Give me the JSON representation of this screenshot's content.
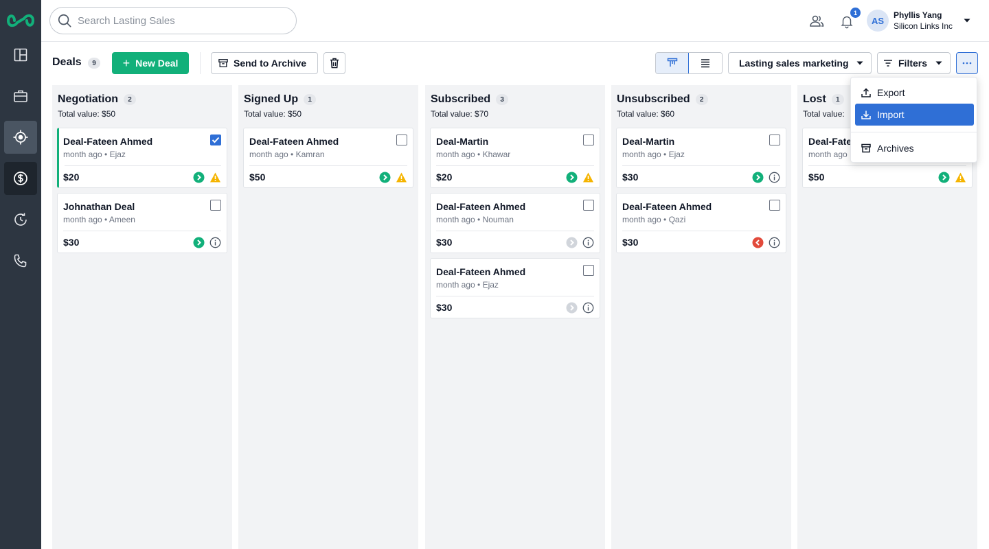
{
  "search": {
    "placeholder": "Search Lasting Sales"
  },
  "header": {
    "notifications_count": "1",
    "user": {
      "initials": "AS",
      "name": "Phyllis Yang",
      "company": "Silicon Links Inc"
    }
  },
  "toolbar": {
    "title": "Deals",
    "count": "9",
    "new_deal_label": "New Deal",
    "archive_label": "Send to Archive",
    "pipeline_label": "Lasting sales marketing",
    "filters_label": "Filters"
  },
  "columns": [
    {
      "title": "Negotiation",
      "count": "2",
      "total": "Total value: $50",
      "cards": [
        {
          "title": "Deal-Fateen Ahmed",
          "meta": "month ago • Ejaz",
          "value": "$20",
          "checked": true,
          "status": "green",
          "alert": "warning"
        },
        {
          "title": "Johnathan Deal",
          "meta": "month ago • Ameen",
          "value": "$30",
          "checked": false,
          "status": "green",
          "alert": "info"
        }
      ]
    },
    {
      "title": "Signed Up",
      "count": "1",
      "total": "Total value: $50",
      "cards": [
        {
          "title": "Deal-Fateen Ahmed",
          "meta": "month ago • Kamran",
          "value": "$50",
          "checked": false,
          "status": "green",
          "alert": "warning"
        }
      ]
    },
    {
      "title": "Subscribed",
      "count": "3",
      "total": "Total value: $70",
      "cards": [
        {
          "title": "Deal-Martin",
          "meta": "month ago • Khawar",
          "value": "$20",
          "checked": false,
          "status": "green",
          "alert": "warning"
        },
        {
          "title": "Deal-Fateen Ahmed",
          "meta": "month ago • Nouman",
          "value": "$30",
          "checked": false,
          "status": "gray",
          "alert": "info"
        },
        {
          "title": "Deal-Fateen Ahmed",
          "meta": "month ago • Ejaz",
          "value": "$30",
          "checked": false,
          "status": "gray",
          "alert": "info"
        }
      ]
    },
    {
      "title": "Unsubscribed",
      "count": "2",
      "total": "Total value: $60",
      "cards": [
        {
          "title": "Deal-Martin",
          "meta": "month ago • Ejaz",
          "value": "$30",
          "checked": false,
          "status": "green",
          "alert": "info"
        },
        {
          "title": "Deal-Fateen Ahmed",
          "meta": "month ago • Qazi",
          "value": "$30",
          "checked": false,
          "status": "red",
          "alert": "info"
        }
      ]
    },
    {
      "title": "Lost",
      "count": "1",
      "total": "Total value:",
      "cards": [
        {
          "title": "Deal-Fate",
          "meta": "month ago",
          "value": "$50",
          "checked": false,
          "status": "green",
          "alert": "warning"
        }
      ]
    }
  ],
  "menu": {
    "items": [
      {
        "label": "Export",
        "icon": "export-icon"
      },
      {
        "label": "Import",
        "icon": "import-icon",
        "active": true
      },
      {
        "label": "Archives",
        "icon": "archive-icon"
      }
    ]
  },
  "colors": {
    "brand": "#12b07a",
    "accent": "#2f6fd6",
    "sidebar": "#2d3641",
    "warning": "#f5b400",
    "danger": "#e24a3b"
  }
}
